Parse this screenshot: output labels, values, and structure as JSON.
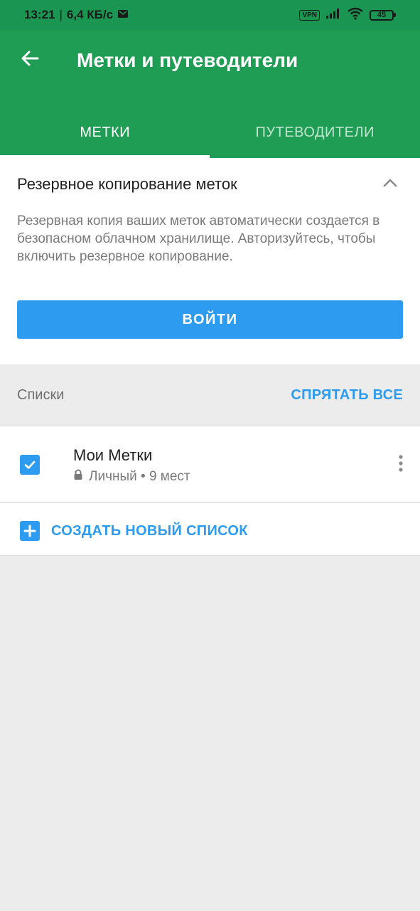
{
  "status_bar": {
    "time": "13:21",
    "separator": "|",
    "speed": "6,4 КБ/с",
    "vpn": "VPN",
    "battery": "45"
  },
  "app_bar": {
    "title": "Метки и путеводители",
    "tabs": [
      {
        "label": "МЕТКИ",
        "active": true
      },
      {
        "label": "ПУТЕВОДИТЕЛИ",
        "active": false
      }
    ]
  },
  "backup": {
    "title": "Резервное копирование меток",
    "description": "Резервная копия ваших меток автоматически создается в безопасном облачном хранилище. Авторизуйтесь, чтобы включить резервное копирование.",
    "login_button": "ВОЙТИ"
  },
  "lists": {
    "header": "Списки",
    "hide_all": "СПРЯТАТЬ ВСЕ",
    "items": [
      {
        "name": "Мои Метки",
        "meta": "Личный • 9 мест",
        "checked": true
      }
    ],
    "create_new": "СОЗДАТЬ НОВЫЙ СПИСОК"
  },
  "colors": {
    "status_bar": "#1b9652",
    "app_bar": "#209d54",
    "accent": "#2d9cf0",
    "background": "#ececec"
  },
  "icons": [
    "back-arrow-icon",
    "chevron-up-icon",
    "checkbox-checked-icon",
    "lock-icon",
    "more-vertical-icon",
    "plus-icon",
    "mail-icon",
    "signal-icon",
    "wifi-icon",
    "battery-icon"
  ]
}
